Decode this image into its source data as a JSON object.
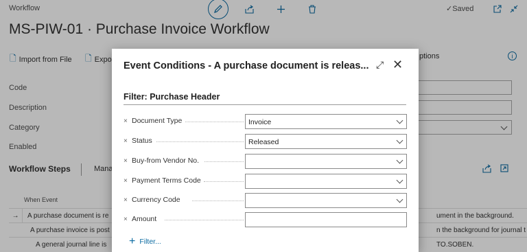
{
  "header": {
    "breadcrumb": "Workflow",
    "saved_label": "Saved",
    "title": "MS-PIW-01 · Purchase Invoice Workflow"
  },
  "actions": {
    "import_label": "Import from File",
    "export_label": "Expo",
    "options_label": "ptions"
  },
  "fields": {
    "code": "Code",
    "description": "Description",
    "category": "Category",
    "enabled": "Enabled"
  },
  "steps": {
    "title": "Workflow Steps",
    "manage_label": "Mana",
    "column_when_event": "When Event",
    "rows": [
      {
        "left": "A purchase document is re",
        "right": "ument in the background."
      },
      {
        "left": "A purchase invoice is post",
        "right": "n the background for journal t"
      },
      {
        "left": "A general journal line is",
        "right": "TO.SOBEN."
      }
    ]
  },
  "dialog": {
    "title": "Event Conditions - A purchase document is releas...",
    "filter_heading": "Filter: Purchase Header",
    "filters": [
      {
        "label": "Document Type",
        "value": "Invoice",
        "dropdown": true
      },
      {
        "label": "Status",
        "value": "Released",
        "dropdown": true
      },
      {
        "label": "Buy-from Vendor No.",
        "value": "",
        "dropdown": true
      },
      {
        "label": "Payment Terms Code",
        "value": "",
        "dropdown": true
      },
      {
        "label": "Currency Code",
        "value": "",
        "dropdown": true
      },
      {
        "label": "Amount",
        "value": "",
        "dropdown": false
      }
    ],
    "add_filter_label": "Filter..."
  },
  "colors": {
    "accent": "#0a6aa1",
    "overlay": "rgba(0,0,0,0.28)"
  }
}
